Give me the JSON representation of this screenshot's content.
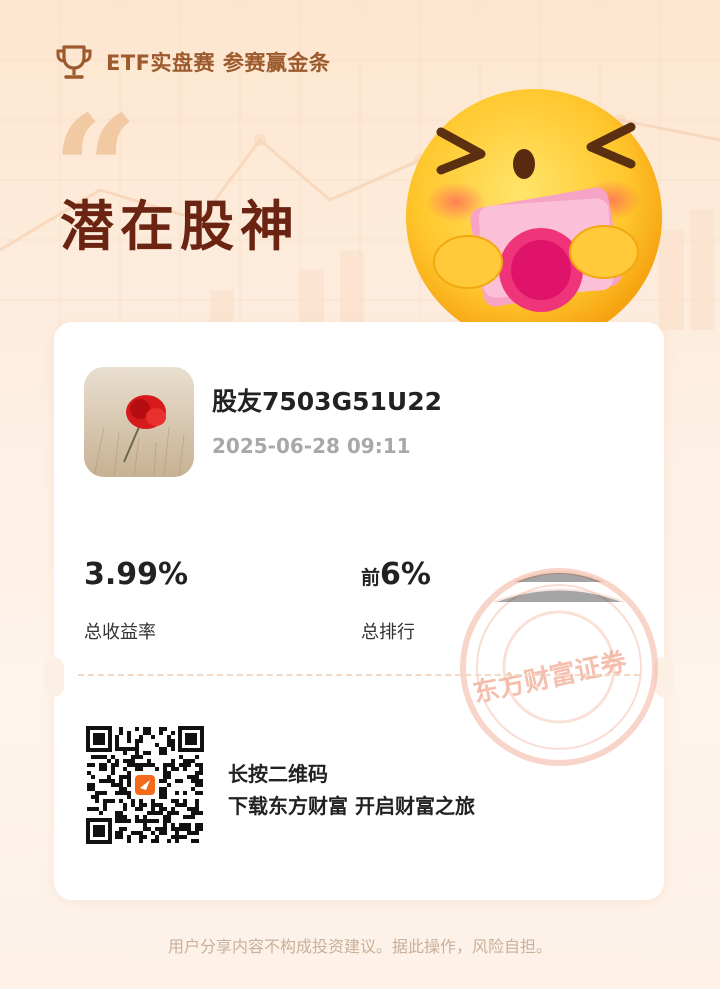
{
  "header": {
    "text": "ETF实盘赛 参赛赢金条",
    "icon": "trophy-icon"
  },
  "title": "潜在股神",
  "quote_mark": "“",
  "user": {
    "name": "股友7503G51U22",
    "datetime": "2025-06-28 09:11"
  },
  "stats": {
    "return_value": "3.99%",
    "return_label": "总收益率",
    "rank_prefix": "前",
    "rank_value": "6%",
    "rank_label": "总排行"
  },
  "qr_section": {
    "line1": "长按二维码",
    "line2": "下载东方财富 开启财富之旅"
  },
  "stamp_text": "东方财富证券",
  "disclaimer": "用户分享内容不构成投资建议。据此操作，风险自担。",
  "colors": {
    "accent_brown": "#9c5a2d",
    "title_color": "#6b2312",
    "stamp_color": "#f2a58c"
  }
}
